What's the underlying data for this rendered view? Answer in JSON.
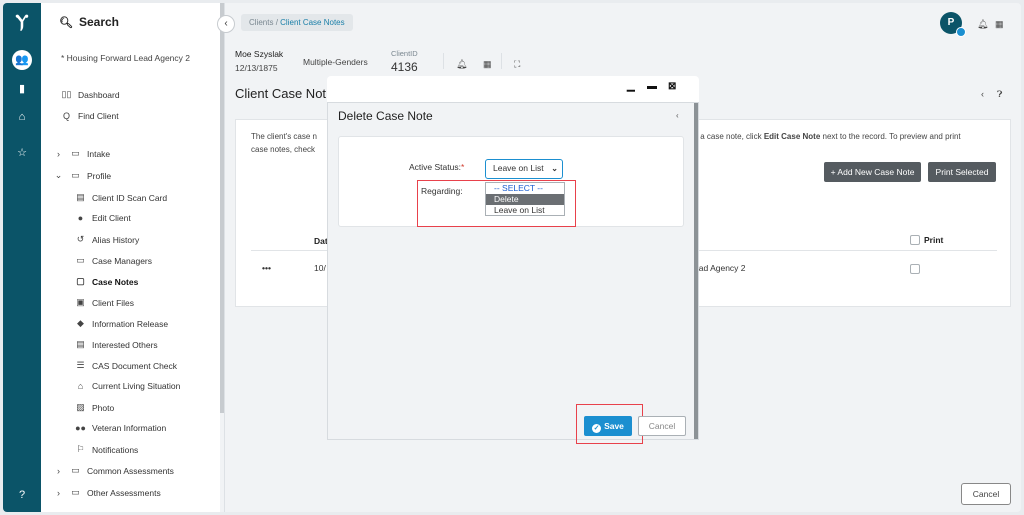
{
  "sidebar": {
    "search_label": "Search",
    "agency": "* Housing Forward Lead Agency 2",
    "items": [
      {
        "label": "Dashboard",
        "icon": "map-icon"
      },
      {
        "label": "Find Client",
        "icon": "search-icon"
      },
      {
        "label": "Intake",
        "icon": "folder-icon"
      },
      {
        "label": "Profile",
        "icon": "folder-icon"
      },
      {
        "label": "Client ID Scan Card",
        "icon": "id-card-icon"
      },
      {
        "label": "Edit Client",
        "icon": "user-icon"
      },
      {
        "label": "Alias History",
        "icon": "history-icon"
      },
      {
        "label": "Case Managers",
        "icon": "folder-icon"
      },
      {
        "label": "Case Notes",
        "icon": "note-icon"
      },
      {
        "label": "Client Files",
        "icon": "file-icon"
      },
      {
        "label": "Information Release",
        "icon": "shield-icon"
      },
      {
        "label": "Interested Others",
        "icon": "id-card-icon"
      },
      {
        "label": "CAS Document Check",
        "icon": "list-icon"
      },
      {
        "label": "Current Living Situation",
        "icon": "home-icon"
      },
      {
        "label": "Photo",
        "icon": "image-icon"
      },
      {
        "label": "Veteran Information",
        "icon": "users-icon"
      },
      {
        "label": "Notifications",
        "icon": "flag-icon"
      },
      {
        "label": "Common Assessments",
        "icon": "folder-icon"
      },
      {
        "label": "Other Assessments",
        "icon": "folder-icon"
      }
    ]
  },
  "breadcrumb": {
    "first": "Clients",
    "separator": "/",
    "current": "Client Case Notes"
  },
  "user": {
    "avatar_initial": "P"
  },
  "client": {
    "name": "Moe Szyslak",
    "dob": "12/13/1875",
    "gender": "Multiple-Genders",
    "id_label": "ClientID",
    "id": "4136"
  },
  "page": {
    "title": "Client Case Not",
    "intro_line1": "The client's case n",
    "intro_line2": "case notes, check",
    "intro_right_prefix": "it a case note, click ",
    "intro_right_bold": "Edit Case Note",
    "intro_right_suffix": " next to the record.  To preview and print",
    "add_button": "+ Add New Case Note",
    "print_button": "Print Selected",
    "col_date": "Dat",
    "col_print": "Print",
    "row_menu": "•••",
    "row_date": "10/",
    "row_agency": "ead Agency 2",
    "cancel_button": "Cancel"
  },
  "modal": {
    "title": "Delete Case Note",
    "active_status_label": "Active Status:",
    "required_mark": "*",
    "active_status_value": "Leave on List",
    "regarding_label": "Regarding:",
    "options": [
      "-- SELECT --",
      "Delete",
      "Leave on List"
    ],
    "save_button": "Save",
    "cancel_button": "Cancel"
  },
  "colors": {
    "rail": "#0b5468",
    "accent": "#1b8fd0",
    "highlight_box": "#e8414b"
  }
}
